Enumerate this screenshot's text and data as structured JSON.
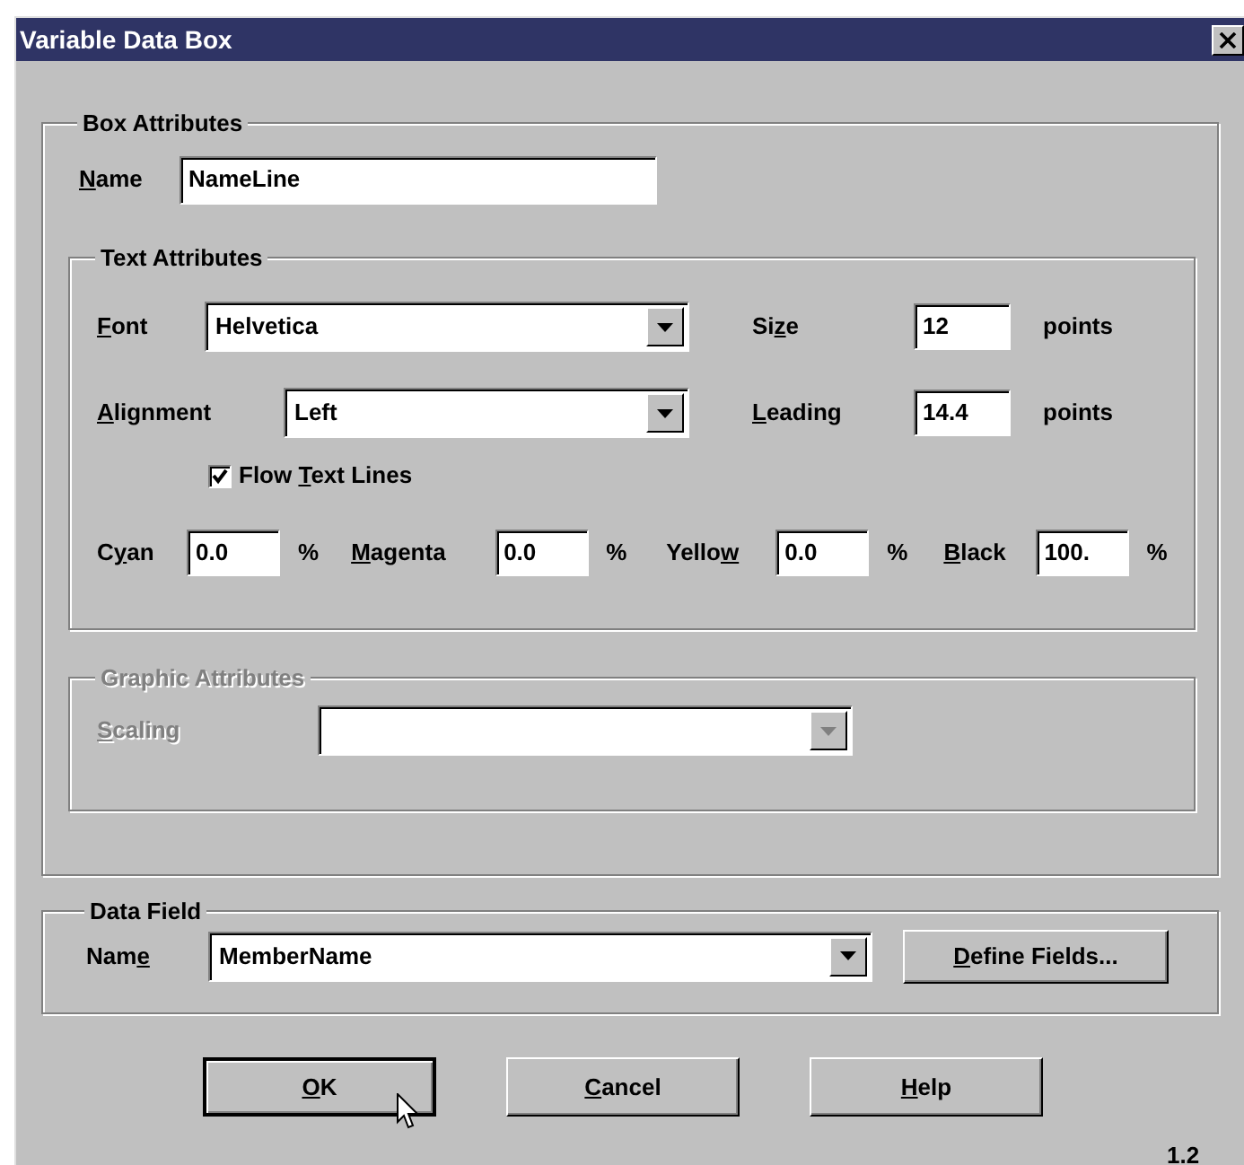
{
  "window": {
    "title": "Variable Data Box"
  },
  "box_attributes": {
    "title": "Box Attributes",
    "name": {
      "label": {
        "key": "N",
        "post": "ame"
      },
      "value": "NameLine"
    }
  },
  "text_attributes": {
    "title": "Text Attributes",
    "font": {
      "label": {
        "key": "F",
        "post": "ont"
      },
      "value": "Helvetica"
    },
    "size": {
      "label": {
        "pre": "Si",
        "key": "z",
        "post": "e"
      },
      "value": "12",
      "unit": "points"
    },
    "alignment": {
      "label": {
        "key": "A",
        "post": "lignment"
      },
      "value": "Left"
    },
    "leading": {
      "label": {
        "key": "L",
        "post": "eading"
      },
      "value": "14.4",
      "unit": "points"
    },
    "flow_text_lines": {
      "label": {
        "pre": "Flow ",
        "key": "T",
        "post": "ext Lines"
      },
      "checked": true
    },
    "inks": [
      {
        "label": {
          "pre": "C",
          "key": "y",
          "post": "an"
        },
        "value": "0.0",
        "unit": "%"
      },
      {
        "label": {
          "key": "M",
          "post": "agenta"
        },
        "value": "0.0",
        "unit": "%"
      },
      {
        "label": {
          "pre": "Yello",
          "key": "w"
        },
        "value": "0.0",
        "unit": "%"
      },
      {
        "label": {
          "key": "B",
          "post": "lack"
        },
        "value": "100.",
        "unit": "%"
      }
    ]
  },
  "graphic_attributes": {
    "title": "Graphic Attributes",
    "disabled": true,
    "scaling": {
      "label": {
        "key": "S",
        "post": "caling"
      }
    }
  },
  "data_field": {
    "title": "Data Field",
    "name": {
      "label": {
        "pre": "Nam",
        "key": "e"
      },
      "value": "MemberName"
    },
    "define_button": {
      "label": {
        "key": "D",
        "post": "efine Fields..."
      }
    }
  },
  "buttons": [
    {
      "label": {
        "key": "O",
        "post": "K"
      },
      "default": true
    },
    {
      "label": {
        "key": "C",
        "post": "ancel"
      },
      "default": false
    },
    {
      "label": {
        "key": "H",
        "post": "elp"
      },
      "default": false
    }
  ],
  "version": "1.2"
}
